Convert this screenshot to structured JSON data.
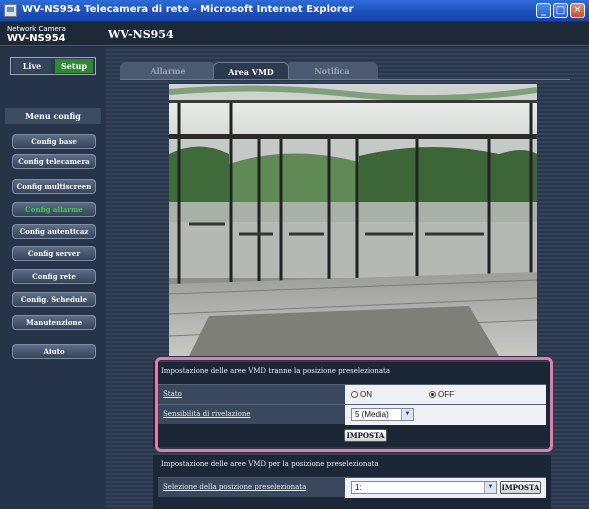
{
  "window": {
    "title": "WV-NS954 Telecamera di rete - Microsoft Internet Explorer",
    "min_glyph": "_",
    "max_glyph": "□",
    "close_glyph": "✕"
  },
  "header": {
    "brand_line1": "Network Camera",
    "brand_line2": "WV-NS954",
    "model": "WV-NS954"
  },
  "sidebar": {
    "live_label": "Live",
    "setup_label": "Setup",
    "menu_title": "Menu config",
    "items": [
      {
        "label": "Config base"
      },
      {
        "label": "Config telecamera"
      },
      {
        "label": "Config multiscreen"
      },
      {
        "label": "Config allarme",
        "active": true
      },
      {
        "label": "Config autenticaz"
      },
      {
        "label": "Config server"
      },
      {
        "label": "Config rete"
      },
      {
        "label": "Config. Schedule"
      },
      {
        "label": "Manutenzione"
      },
      {
        "label": "Aiuto"
      }
    ]
  },
  "tabs": [
    {
      "label": "Allarme"
    },
    {
      "label": "Area VMD",
      "selected": true
    },
    {
      "label": "Notifica"
    }
  ],
  "camera_view": {
    "icon": "camera-image"
  },
  "vmd_section": {
    "title": "Impostazione delle aree VMD tranne la posizione preselezionata",
    "stato_label": "Stato",
    "on_label": "ON",
    "off_label": "OFF",
    "stato_value": "OFF",
    "sens_label": "Sensibilità di rivelazione",
    "sens_value": "5 (Media)",
    "set_button": "IMPOSTA"
  },
  "preset_section": {
    "title": "Impostazione delle aree VMD per la posizione preselezionata",
    "preset_label": "Selezione della posizione preselezionata",
    "preset_value": "1:",
    "set_button": "IMPOSTA"
  },
  "colors": {
    "highlight": "#e87aa8",
    "active_nav": "#3ed03e",
    "setup_green": "#2e8a2e"
  }
}
